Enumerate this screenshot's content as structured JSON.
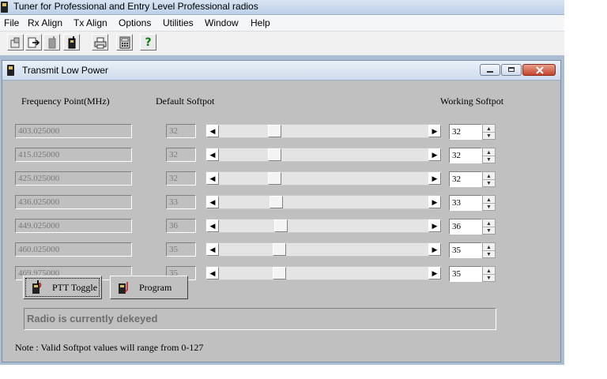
{
  "app": {
    "title": "Tuner for Professional and Entry Level Professional radios"
  },
  "menu": [
    "File",
    "Rx Align",
    "Tx Align",
    "Options",
    "Utilities",
    "Window",
    "Help"
  ],
  "toolbar": {
    "icons": [
      "open-radio-icon",
      "transfer-icon",
      "radio-gray-icon",
      "radio-icon",
      "print-icon",
      "calculator-icon",
      "help-icon"
    ],
    "help_label": "?"
  },
  "window": {
    "title": "Transmit Low Power",
    "controls": [
      "minimize-icon",
      "restore-icon",
      "close-icon"
    ]
  },
  "headers": {
    "frequency": "Frequency Point(MHz)",
    "default": "Default Softpot",
    "working": "Working Softpot"
  },
  "rows": [
    {
      "frequency": "403.025000",
      "default": "32",
      "working": "32",
      "softpot_value": 32
    },
    {
      "frequency": "415.025000",
      "default": "32",
      "working": "32",
      "softpot_value": 32
    },
    {
      "frequency": "425.025000",
      "default": "32",
      "working": "32",
      "softpot_value": 32
    },
    {
      "frequency": "436.025000",
      "default": "33",
      "working": "33",
      "softpot_value": 33
    },
    {
      "frequency": "449.025000",
      "default": "36",
      "working": "36",
      "softpot_value": 36
    },
    {
      "frequency": "460.025000",
      "default": "35",
      "working": "35",
      "softpot_value": 35
    },
    {
      "frequency": "469.975000",
      "default": "35",
      "working": "35",
      "softpot_value": 35
    }
  ],
  "softpot_range": [
    0,
    127
  ],
  "buttons": {
    "ptt": "PTT Toggle",
    "program": "Program"
  },
  "status": "Radio is currently dekeyed",
  "note": "Note : Valid Softpot values will range from 0-127"
}
